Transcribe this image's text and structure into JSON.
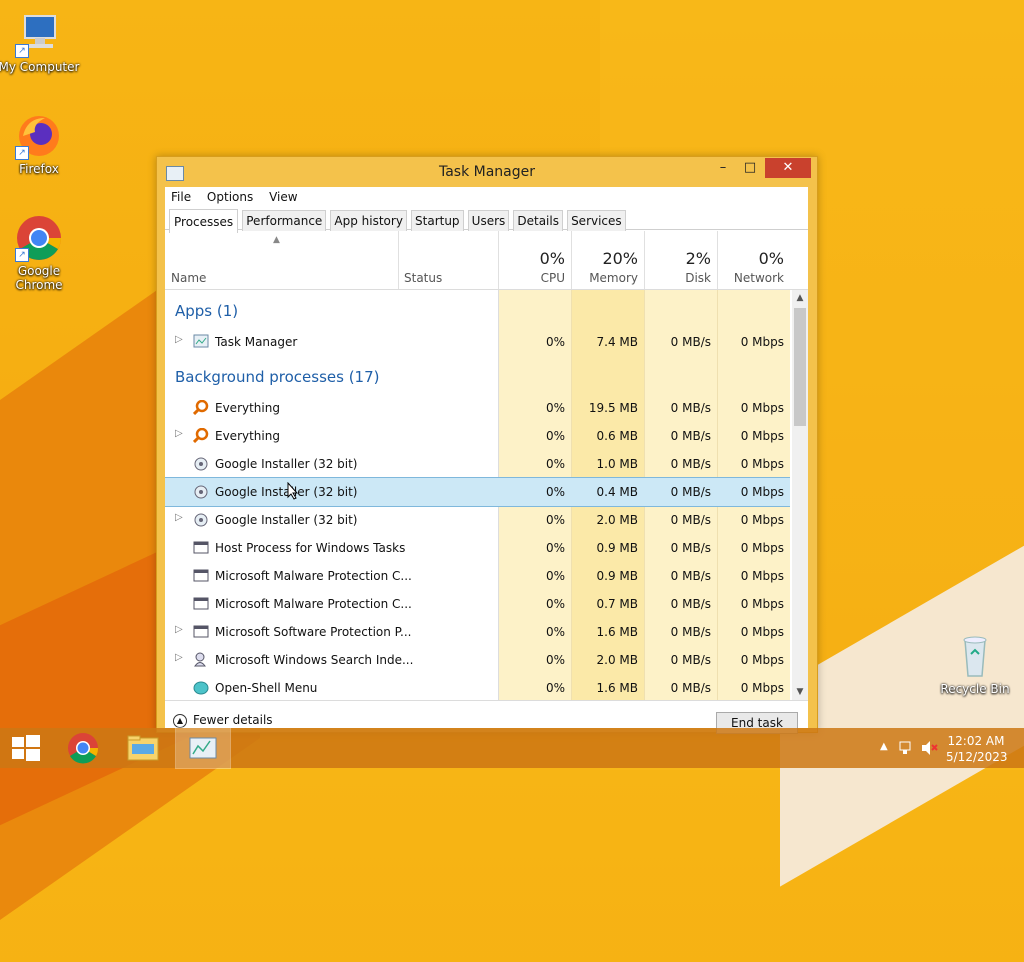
{
  "desktop": {
    "icons": [
      {
        "label": "My Computer"
      },
      {
        "label": "Firefox"
      },
      {
        "label": "Google Chrome"
      },
      {
        "label": "Recycle Bin"
      }
    ]
  },
  "window": {
    "title": "Task Manager",
    "menu": [
      "File",
      "Options",
      "View"
    ],
    "tabs": [
      "Processes",
      "Performance",
      "App history",
      "Startup",
      "Users",
      "Details",
      "Services"
    ],
    "active_tab": "Processes",
    "columns": {
      "name": "Name",
      "status": "Status",
      "cpu": {
        "pct": "0%",
        "label": "CPU"
      },
      "memory": {
        "pct": "20%",
        "label": "Memory"
      },
      "disk": {
        "pct": "2%",
        "label": "Disk"
      },
      "network": {
        "pct": "0%",
        "label": "Network"
      }
    },
    "groups": {
      "apps": "Apps (1)",
      "background": "Background processes (17)"
    },
    "rows": [
      {
        "name": "Task Manager",
        "cpu": "0%",
        "mem": "7.4 MB",
        "disk": "0 MB/s",
        "net": "0 Mbps"
      },
      {
        "name": "Everything",
        "cpu": "0%",
        "mem": "19.5 MB",
        "disk": "0 MB/s",
        "net": "0 Mbps"
      },
      {
        "name": "Everything",
        "cpu": "0%",
        "mem": "0.6 MB",
        "disk": "0 MB/s",
        "net": "0 Mbps"
      },
      {
        "name": "Google Installer (32 bit)",
        "cpu": "0%",
        "mem": "1.0 MB",
        "disk": "0 MB/s",
        "net": "0 Mbps"
      },
      {
        "name": "Google Installer (32 bit)",
        "cpu": "0%",
        "mem": "0.4 MB",
        "disk": "0 MB/s",
        "net": "0 Mbps"
      },
      {
        "name": "Google Installer (32 bit)",
        "cpu": "0%",
        "mem": "2.0 MB",
        "disk": "0 MB/s",
        "net": "0 Mbps"
      },
      {
        "name": "Host Process for Windows Tasks",
        "cpu": "0%",
        "mem": "0.9 MB",
        "disk": "0 MB/s",
        "net": "0 Mbps"
      },
      {
        "name": "Microsoft Malware Protection C...",
        "cpu": "0%",
        "mem": "0.9 MB",
        "disk": "0 MB/s",
        "net": "0 Mbps"
      },
      {
        "name": "Microsoft Malware Protection C...",
        "cpu": "0%",
        "mem": "0.7 MB",
        "disk": "0 MB/s",
        "net": "0 Mbps"
      },
      {
        "name": "Microsoft Software Protection P...",
        "cpu": "0%",
        "mem": "1.6 MB",
        "disk": "0 MB/s",
        "net": "0 Mbps"
      },
      {
        "name": "Microsoft Windows Search Inde...",
        "cpu": "0%",
        "mem": "2.0 MB",
        "disk": "0 MB/s",
        "net": "0 Mbps"
      },
      {
        "name": "Open-Shell Menu",
        "cpu": "0%",
        "mem": "1.6 MB",
        "disk": "0 MB/s",
        "net": "0 Mbps"
      }
    ],
    "fewer_details": "Fewer details",
    "end_task": "End task"
  },
  "taskbar": {
    "time": "12:02 AM",
    "date": "5/12/2023"
  }
}
